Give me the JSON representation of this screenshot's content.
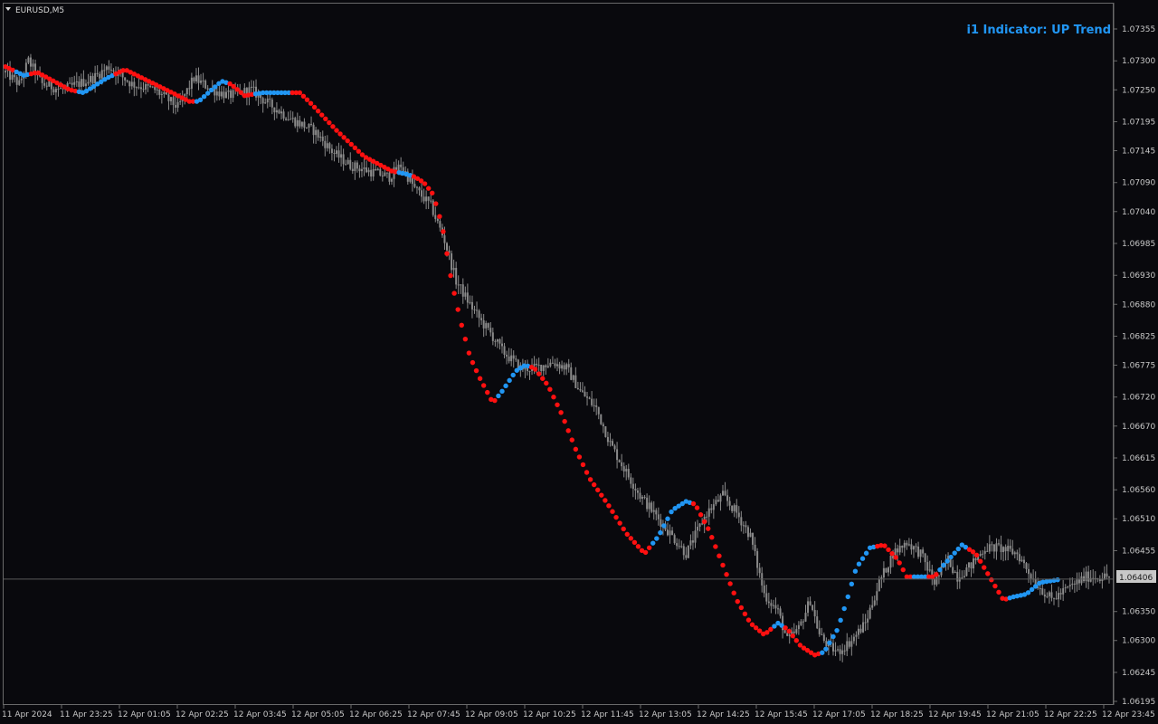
{
  "window": {
    "symbol": "EURUSD,M5"
  },
  "indicator": {
    "label": "i1 Indicator: UP Trend",
    "color": "#2196f3"
  },
  "colors": {
    "background": "#09090d",
    "candle": "#8a8a8a",
    "up": "#2196f3",
    "down": "#ff1010",
    "axis_text": "#c8c8c8",
    "price_line": "#5a5a5a"
  },
  "chart_data": {
    "type": "candlestick",
    "title": "",
    "ylim": [
      1.06195,
      1.0738
    ],
    "y_ticks": [
      "1.07355",
      "1.07300",
      "1.07250",
      "1.07195",
      "1.07145",
      "1.07090",
      "1.07040",
      "1.06985",
      "1.06930",
      "1.06880",
      "1.06825",
      "1.06775",
      "1.06720",
      "1.06670",
      "1.06615",
      "1.06560",
      "1.06510",
      "1.06455",
      "1.06406",
      "1.06350",
      "1.06300",
      "1.06245",
      "1.06195"
    ],
    "x_ticks": [
      "11 Apr 2024",
      "11 Apr 23:25",
      "12 Apr 01:05",
      "12 Apr 02:25",
      "12 Apr 03:45",
      "12 Apr 05:05",
      "12 Apr 06:25",
      "12 Apr 07:45",
      "12 Apr 09:05",
      "12 Apr 10:25",
      "12 Apr 11:45",
      "12 Apr 13:05",
      "12 Apr 14:25",
      "12 Apr 15:45",
      "12 Apr 17:05",
      "12 Apr 18:25",
      "12 Apr 19:45",
      "12 Apr 21:05",
      "12 Apr 22:25",
      "12 Apr 23:45"
    ],
    "current_price": "1.06406",
    "close_series_bars": 305,
    "price_path": [
      [
        0,
        1.0728
      ],
      [
        6,
        1.0726
      ],
      [
        10,
        1.073
      ],
      [
        16,
        1.0726
      ],
      [
        25,
        1.0725
      ],
      [
        38,
        1.0727
      ],
      [
        45,
        1.0729
      ],
      [
        55,
        1.0726
      ],
      [
        65,
        1.0725
      ],
      [
        75,
        1.0722
      ],
      [
        82,
        1.0727
      ],
      [
        90,
        1.0725
      ],
      [
        97,
        1.0724
      ],
      [
        107,
        1.0725
      ],
      [
        113,
        1.0723
      ],
      [
        124,
        1.072
      ],
      [
        134,
        1.0718
      ],
      [
        143,
        1.0714
      ],
      [
        150,
        1.0712
      ],
      [
        158,
        1.0711
      ],
      [
        167,
        1.071
      ],
      [
        172,
        1.0712
      ],
      [
        178,
        1.0708
      ],
      [
        185,
        1.0705
      ],
      [
        188,
        1.0702
      ],
      [
        191,
        1.0699
      ],
      [
        196,
        1.0692
      ],
      [
        202,
        1.0688
      ],
      [
        207,
        1.0685
      ],
      [
        211,
        1.0683
      ],
      [
        216,
        1.068
      ],
      [
        224,
        1.0677
      ],
      [
        230,
        1.0677
      ],
      [
        238,
        1.0678
      ],
      [
        244,
        1.0677
      ],
      [
        250,
        1.0673
      ],
      [
        257,
        1.067
      ],
      [
        263,
        1.0664
      ],
      [
        270,
        1.0659
      ],
      [
        276,
        1.0655
      ],
      [
        282,
        1.0652
      ],
      [
        288,
        1.0649
      ],
      [
        296,
        1.0645
      ],
      [
        305,
        1.0652
      ],
      [
        312,
        1.0655
      ],
      [
        318,
        1.0652
      ],
      [
        324,
        1.0648
      ],
      [
        330,
        1.0638
      ],
      [
        336,
        1.0635
      ],
      [
        340,
        1.063
      ],
      [
        345,
        1.0632
      ],
      [
        350,
        1.0637
      ],
      [
        354,
        1.0631
      ],
      [
        358,
        1.0629
      ],
      [
        362,
        1.0628
      ],
      [
        368,
        1.063
      ],
      [
        374,
        1.0633
      ],
      [
        380,
        1.064
      ],
      [
        386,
        1.0645
      ],
      [
        392,
        1.0647
      ],
      [
        398,
        1.0645
      ],
      [
        404,
        1.064
      ],
      [
        410,
        1.0644
      ],
      [
        414,
        1.0641
      ],
      [
        420,
        1.0643
      ],
      [
        426,
        1.0646
      ],
      [
        432,
        1.0646
      ],
      [
        440,
        1.0645
      ],
      [
        448,
        1.064
      ],
      [
        455,
        1.0637
      ],
      [
        462,
        1.0639
      ],
      [
        470,
        1.0641
      ],
      [
        480,
        1.0641
      ]
    ],
    "series": [
      {
        "type": "dots",
        "points": [
          [
            0,
            1.0729,
            "down"
          ],
          [
            8,
            1.07275,
            "up"
          ],
          [
            14,
            1.0728,
            "down"
          ],
          [
            28,
            1.0725,
            "down"
          ],
          [
            34,
            1.07245,
            "up"
          ],
          [
            44,
            1.0727,
            "up"
          ],
          [
            52,
            1.07285,
            "down"
          ],
          [
            70,
            1.0725,
            "down"
          ],
          [
            80,
            1.0723,
            "down"
          ],
          [
            84,
            1.0723,
            "up"
          ],
          [
            94,
            1.07265,
            "up"
          ],
          [
            98,
            1.0726,
            "down"
          ],
          [
            104,
            1.0724,
            "down"
          ],
          [
            112,
            1.07245,
            "up"
          ],
          [
            120,
            1.07245,
            "up"
          ],
          [
            128,
            1.07245,
            "down"
          ],
          [
            132,
            1.0723,
            "down"
          ],
          [
            144,
            1.0718,
            "down"
          ],
          [
            156,
            1.07135,
            "down"
          ],
          [
            168,
            1.0711,
            "down"
          ],
          [
            174,
            1.07105,
            "up"
          ],
          [
            178,
            1.071,
            "down"
          ],
          [
            182,
            1.0709,
            "down"
          ],
          [
            186,
            1.0707,
            "down"
          ],
          [
            190,
            1.07015,
            "down"
          ],
          [
            194,
            1.0692,
            "down"
          ],
          [
            198,
            1.0685,
            "down"
          ],
          [
            202,
            1.0679,
            "down"
          ],
          [
            206,
            1.06755,
            "down"
          ],
          [
            212,
            1.0671,
            "down"
          ],
          [
            216,
            1.0673,
            "up"
          ],
          [
            222,
            1.06765,
            "up"
          ],
          [
            226,
            1.06775,
            "up"
          ],
          [
            230,
            1.0677,
            "down"
          ],
          [
            236,
            1.0674,
            "down"
          ],
          [
            242,
            1.0669,
            "down"
          ],
          [
            248,
            1.0663,
            "down"
          ],
          [
            254,
            1.0658,
            "down"
          ],
          [
            262,
            1.06535,
            "down"
          ],
          [
            270,
            1.06485,
            "down"
          ],
          [
            278,
            1.0645,
            "down"
          ],
          [
            284,
            1.0648,
            "up"
          ],
          [
            290,
            1.06525,
            "up"
          ],
          [
            296,
            1.0654,
            "up"
          ],
          [
            300,
            1.06535,
            "down"
          ],
          [
            306,
            1.0649,
            "down"
          ],
          [
            312,
            1.0643,
            "down"
          ],
          [
            318,
            1.0637,
            "down"
          ],
          [
            324,
            1.0633,
            "down"
          ],
          [
            330,
            1.0631,
            "down"
          ],
          [
            336,
            1.0633,
            "up"
          ],
          [
            340,
            1.0632,
            "down"
          ],
          [
            346,
            1.0629,
            "down"
          ],
          [
            352,
            1.06275,
            "down"
          ],
          [
            356,
            1.0628,
            "up"
          ],
          [
            362,
            1.0632,
            "up"
          ],
          [
            366,
            1.0637,
            "up"
          ],
          [
            370,
            1.06425,
            "up"
          ],
          [
            376,
            1.0646,
            "up"
          ],
          [
            382,
            1.06465,
            "down"
          ],
          [
            388,
            1.0644,
            "down"
          ],
          [
            392,
            1.0641,
            "down"
          ],
          [
            398,
            1.0641,
            "up"
          ],
          [
            404,
            1.0641,
            "down"
          ],
          [
            408,
            1.0643,
            "up"
          ],
          [
            416,
            1.06465,
            "up"
          ],
          [
            422,
            1.0645,
            "down"
          ],
          [
            428,
            1.0641,
            "down"
          ],
          [
            434,
            1.0637,
            "down"
          ],
          [
            438,
            1.06375,
            "up"
          ],
          [
            444,
            1.0638,
            "up"
          ],
          [
            450,
            1.064,
            "up"
          ],
          [
            458,
            1.06405,
            "up"
          ]
        ]
      }
    ]
  }
}
